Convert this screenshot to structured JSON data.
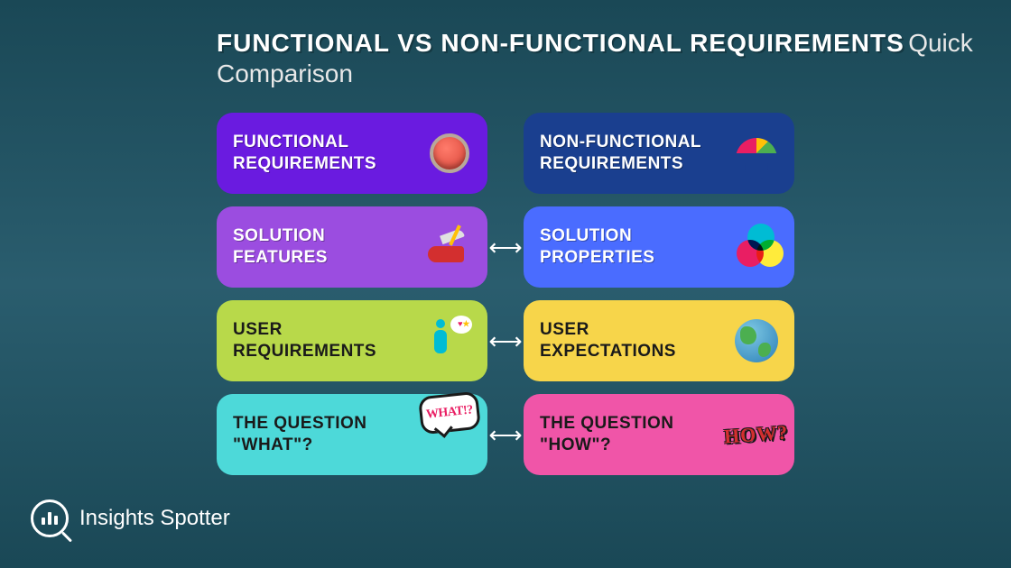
{
  "header": {
    "title_bold": "FUNCTIONAL VS NON-FUNCTIONAL REQUIREMENTS",
    "title_light": "Quick Comparison"
  },
  "rows": [
    {
      "left": {
        "label_l1": "FUNCTIONAL",
        "label_l2": "REQUIREMENTS",
        "bg": "#6a1be0",
        "dark_text": false,
        "icon": "button-icon"
      },
      "arrow": false,
      "right": {
        "label_l1": "NON-FUNCTIONAL",
        "label_l2": "REQUIREMENTS",
        "bg": "#1a3f8f",
        "dark_text": false,
        "icon": "gauge-icon"
      }
    },
    {
      "left": {
        "label_l1": "SOLUTION",
        "label_l2": "FEATURES",
        "bg": "#9b4de0",
        "dark_text": false,
        "icon": "swiss-knife-icon"
      },
      "arrow": true,
      "right": {
        "label_l1": "SOLUTION",
        "label_l2": "PROPERTIES",
        "bg": "#4a6cff",
        "dark_text": false,
        "icon": "venn-icon"
      }
    },
    {
      "left": {
        "label_l1": "USER",
        "label_l2": "REQUIREMENTS",
        "bg": "#b8d94a",
        "dark_text": true,
        "icon": "person-thought-icon"
      },
      "arrow": true,
      "right": {
        "label_l1": "USER",
        "label_l2": "EXPECTATIONS",
        "bg": "#f7d54a",
        "dark_text": true,
        "icon": "globe-icon"
      }
    },
    {
      "left": {
        "label_l1": "THE QUESTION",
        "label_l2": "\"WHAT\"?",
        "bg": "#4dd9d9",
        "dark_text": true,
        "icon": "what-bubble-icon",
        "icon_text": "WHAT!?"
      },
      "arrow": true,
      "right": {
        "label_l1": "THE QUESTION",
        "label_l2": "\"HOW\"?",
        "bg": "#f055a8",
        "dark_text": true,
        "icon": "how-text-icon",
        "icon_text": "HOW?"
      }
    }
  ],
  "brand": {
    "name": "Insights Spotter"
  },
  "arrow_glyph": "⟷"
}
